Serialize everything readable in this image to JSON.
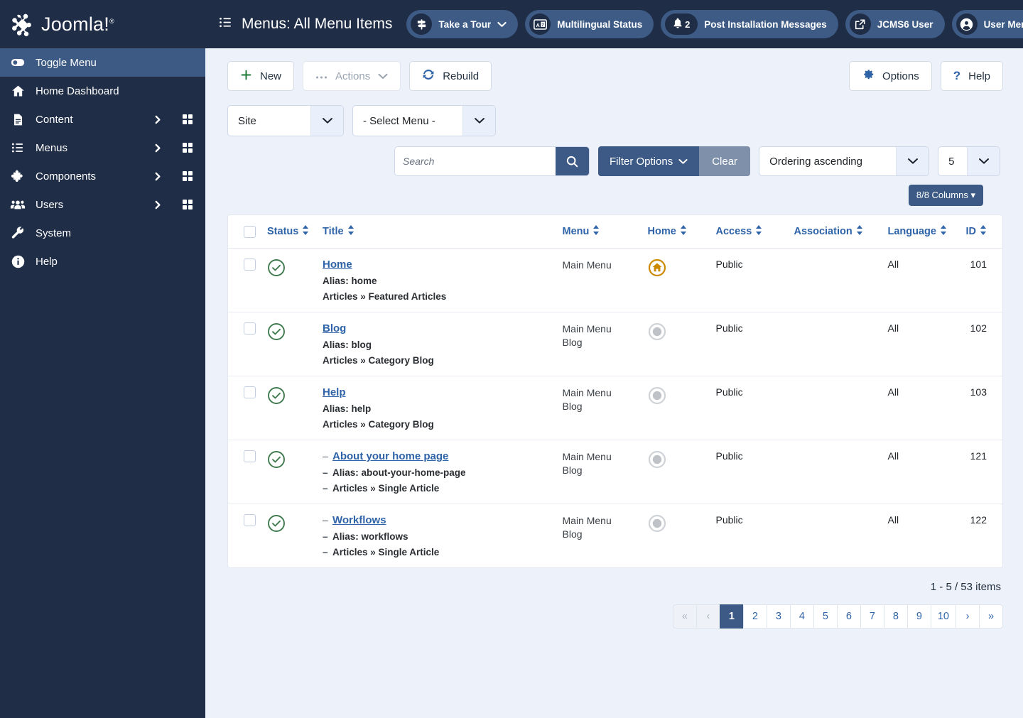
{
  "brand": {
    "name": "Joomla!",
    "trademark": "®",
    "logo_icon": "joomla-logo-icon"
  },
  "sidebar": {
    "items": [
      {
        "label": "Toggle Menu",
        "icon": "toggle-icon",
        "active": true,
        "caret": false,
        "grid": false
      },
      {
        "label": "Home Dashboard",
        "icon": "home-icon",
        "active": false,
        "caret": false,
        "grid": false
      },
      {
        "label": "Content",
        "icon": "document-icon",
        "active": false,
        "caret": true,
        "grid": true
      },
      {
        "label": "Menus",
        "icon": "list-icon",
        "active": false,
        "caret": true,
        "grid": true
      },
      {
        "label": "Components",
        "icon": "puzzle-icon",
        "active": false,
        "caret": true,
        "grid": true
      },
      {
        "label": "Users",
        "icon": "users-icon",
        "active": false,
        "caret": true,
        "grid": true
      },
      {
        "label": "System",
        "icon": "wrench-icon",
        "active": false,
        "caret": false,
        "grid": false
      },
      {
        "label": "Help",
        "icon": "info-icon",
        "active": false,
        "caret": false,
        "grid": false
      }
    ]
  },
  "header": {
    "title": "Menus: All Menu Items",
    "title_icon": "list-icon",
    "pills": [
      {
        "label": "Take a Tour",
        "icon": "signpost-icon",
        "caret": true,
        "badge": null
      },
      {
        "label": "Multilingual Status",
        "icon": "language-icon",
        "caret": false,
        "badge": null
      },
      {
        "label": "Post Installation Messages",
        "icon": "bell-icon",
        "caret": false,
        "badge": "2"
      },
      {
        "label": "JCMS6 User",
        "icon": "external-link-icon",
        "caret": false,
        "badge": null
      },
      {
        "label": "User Menu",
        "icon": "user-circle-icon",
        "caret": true,
        "badge": null
      }
    ],
    "overflow_label": "•••"
  },
  "toolbar": {
    "new_label": "New",
    "actions_label": "Actions",
    "rebuild_label": "Rebuild",
    "options_label": "Options",
    "help_label": "Help"
  },
  "filters": {
    "client_select": "Site",
    "menu_select": "- Select Menu -",
    "search_placeholder": "Search",
    "search_value": "",
    "filter_options_label": "Filter Options",
    "clear_label": "Clear",
    "ordering_select": "Ordering ascending",
    "limit_select": "5",
    "columns_label": "8/8 Columns"
  },
  "table": {
    "columns": [
      {
        "key": "check",
        "label": "",
        "sortable": false
      },
      {
        "key": "status",
        "label": "Status",
        "sortable": true
      },
      {
        "key": "title",
        "label": "Title",
        "sortable": true
      },
      {
        "key": "menu",
        "label": "Menu",
        "sortable": true
      },
      {
        "key": "home",
        "label": "Home",
        "sortable": true
      },
      {
        "key": "access",
        "label": "Access",
        "sortable": true
      },
      {
        "key": "association",
        "label": "Association",
        "sortable": true
      },
      {
        "key": "language",
        "label": "Language",
        "sortable": true
      },
      {
        "key": "id",
        "label": "ID",
        "sortable": true
      }
    ],
    "rows": [
      {
        "status": "published",
        "status_icon": "check-circle-icon",
        "indent": false,
        "title": "Home",
        "alias": "Alias: home",
        "type": "Articles » Featured Articles",
        "menu": "Main Menu",
        "menu_sub": "",
        "home": "yes",
        "home_icon": "home-star-icon",
        "access": "Public",
        "association": "",
        "language": "All",
        "id": "101"
      },
      {
        "status": "published",
        "status_icon": "check-circle-icon",
        "indent": false,
        "title": "Blog",
        "alias": "Alias: blog",
        "type": "Articles » Category Blog",
        "menu": "Main Menu",
        "menu_sub": "Blog",
        "home": "no",
        "home_icon": "circle-icon",
        "access": "Public",
        "association": "",
        "language": "All",
        "id": "102"
      },
      {
        "status": "published",
        "status_icon": "check-circle-icon",
        "indent": false,
        "title": "Help",
        "alias": "Alias: help",
        "type": "Articles » Category Blog",
        "menu": "Main Menu",
        "menu_sub": "Blog",
        "home": "no",
        "home_icon": "circle-icon",
        "access": "Public",
        "association": "",
        "language": "All",
        "id": "103"
      },
      {
        "status": "published",
        "status_icon": "check-circle-icon",
        "indent": true,
        "title": "About your home page",
        "alias": "Alias: about-your-home-page",
        "type": "Articles » Single Article",
        "menu": "Main Menu",
        "menu_sub": "Blog",
        "home": "no",
        "home_icon": "circle-icon",
        "access": "Public",
        "association": "",
        "language": "All",
        "id": "121"
      },
      {
        "status": "published",
        "status_icon": "check-circle-icon",
        "indent": true,
        "title": "Workflows",
        "alias": "Alias: workflows",
        "type": "Articles » Single Article",
        "menu": "Main Menu",
        "menu_sub": "Blog",
        "home": "no",
        "home_icon": "circle-icon",
        "access": "Public",
        "association": "",
        "language": "All",
        "id": "122"
      }
    ]
  },
  "pagination": {
    "counter": "1 - 5 / 53 items",
    "first_label": "«",
    "prev_label": "‹",
    "pages": [
      "1",
      "2",
      "3",
      "4",
      "5",
      "6",
      "7",
      "8",
      "9",
      "10"
    ],
    "current_page": "1",
    "next_label": "›",
    "last_label": "»"
  },
  "colors": {
    "brand_dark": "#1f2d47",
    "accent_blue": "#3c5a85",
    "link_blue": "#2f63a8",
    "page_bg": "#edf1fa",
    "status_green": "#3f7a4e",
    "home_orange": "#cc8a00",
    "muted_gray": "#7f91aa"
  }
}
